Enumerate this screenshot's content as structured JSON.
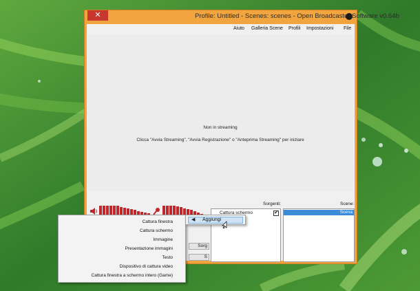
{
  "window": {
    "title": "Profile: Untitled - Scenes: scenes - Open Broadcaster Software v0.64b",
    "close_glyph": "✕"
  },
  "menubar": {
    "items": [
      "File",
      "Impostazioni",
      "Profili",
      "Galleria Scene",
      "Aiuto"
    ]
  },
  "preview": {
    "line1": "Non in streaming",
    "line2": "Clicca \"Avvia Streaming\", \"Avvia Registrazione\" o \"Anteprima Streaming\" per iniziare"
  },
  "meters": {
    "desktop_icon": "speaker-icon",
    "mic_icon": "microphone-icon",
    "accent": "#c0262a"
  },
  "sources": {
    "label": "Sorgenti:",
    "items": [
      {
        "name": "Cattura schermo",
        "checked": true
      }
    ]
  },
  "scenes": {
    "label": "Scene:",
    "items": [
      {
        "name": "Scena",
        "selected": true
      }
    ]
  },
  "buttons": {
    "partial_sorg": "Sorg",
    "partial_s": "S"
  },
  "context_menu": {
    "add_label": "Aggiungi",
    "submenu_arrow": "◀",
    "items": [
      "Cattura finestra",
      "Cattura schermo",
      "Immagine",
      "Presentazione immagini",
      "Testo",
      "Dispositivo di cattura video",
      "Cattura finestra a schermo intero (Game)"
    ]
  }
}
